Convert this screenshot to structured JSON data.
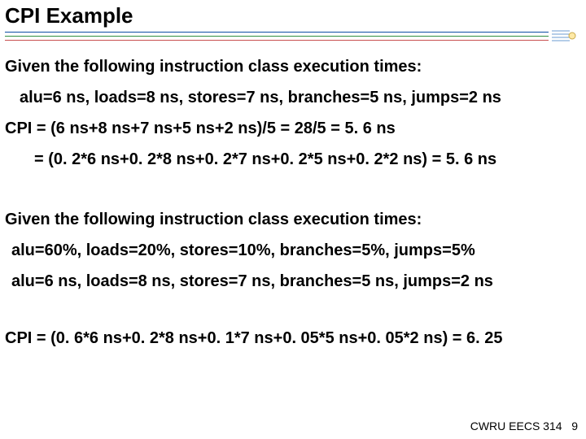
{
  "title": "CPI Example",
  "lines": {
    "intro1": "Given the following instruction class execution times:",
    "times1": "alu=6 ns, loads=8 ns, stores=7 ns, branches=5 ns, jumps=2 ns",
    "cpi1": "CPI = (6 ns+8 ns+7 ns+5 ns+2 ns)/5 = 28/5 = 5. 6 ns",
    "eq1": "= (0. 2*6 ns+0. 2*8 ns+0. 2*7 ns+0. 2*5 ns+0. 2*2 ns) = 5. 6 ns",
    "intro2": "Given the following instruction class execution times:",
    "pct": "alu=60%, loads=20%, stores=10%, branches=5%, jumps=5%",
    "times2": "alu=6 ns, loads=8 ns, stores=7 ns, branches=5 ns, jumps=2 ns",
    "cpi2": "CPI = (0. 6*6 ns+0. 2*8 ns+0. 1*7 ns+0. 05*5 ns+0. 05*2 ns) = 6. 25"
  },
  "footer": {
    "course": "CWRU EECS 314",
    "page": "9"
  }
}
